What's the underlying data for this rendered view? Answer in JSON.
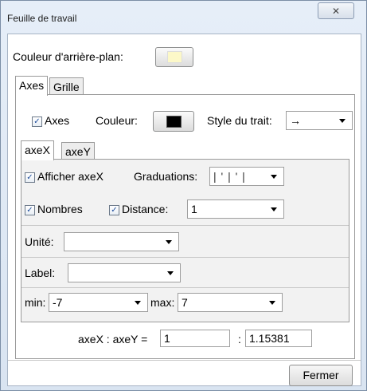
{
  "window": {
    "title": "Feuille de travail",
    "close_glyph": "✕"
  },
  "background": {
    "label": "Couleur d'arrière-plan:",
    "color": "#fcf8c8"
  },
  "tabs": [
    {
      "label": "Axes"
    },
    {
      "label": "Grille"
    }
  ],
  "axes": {
    "checked": true,
    "label": "Axes",
    "color_label": "Couleur:",
    "color": "#000000",
    "style_label": "Style du trait:",
    "style_value": "→"
  },
  "subtabs": [
    {
      "label": "axeX"
    },
    {
      "label": "axeY"
    }
  ],
  "axex": {
    "show_label": "Afficher axeX",
    "graduations_label": "Graduations:",
    "graduations_value": "| ' | ' |",
    "numbers_label": "Nombres",
    "distance_label": "Distance:",
    "distance_value": "1",
    "unit_label": "Unité:",
    "unit_value": "",
    "label_label": "Label:",
    "label_value": "",
    "min_label": "min:",
    "min_value": "-7",
    "max_label": "max:",
    "max_value": "7"
  },
  "ratio": {
    "label": "axeX : axeY =",
    "value1": "1",
    "sep": ":",
    "value2": "1.15381"
  },
  "buttons": {
    "close": "Fermer"
  }
}
